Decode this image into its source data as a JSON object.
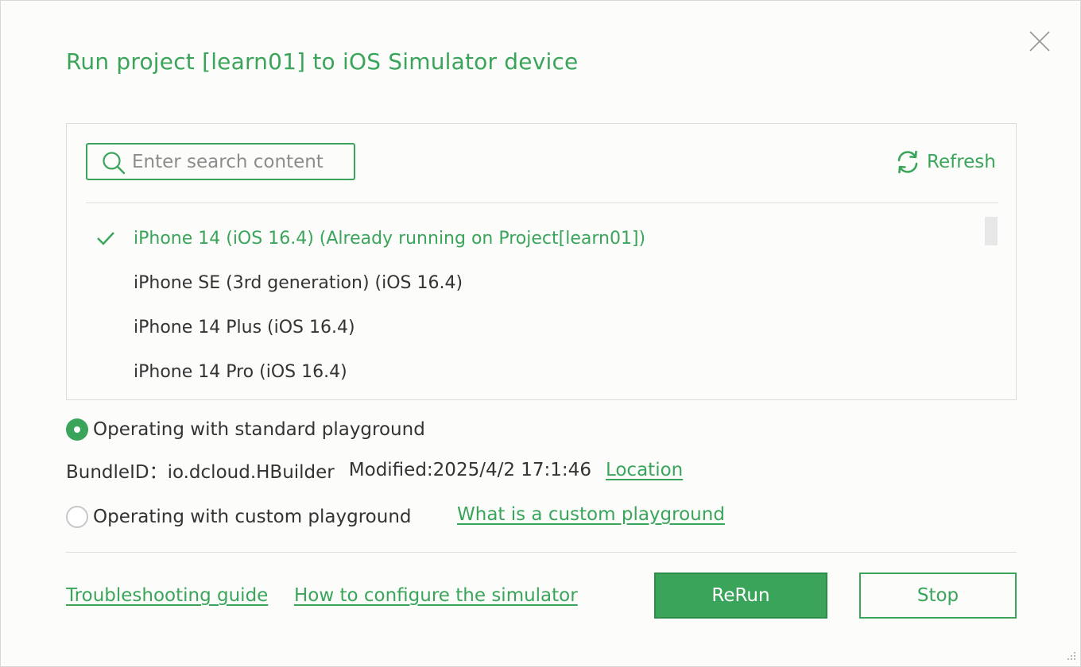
{
  "dialog": {
    "title": "Run project [learn01] to iOS Simulator device"
  },
  "search": {
    "placeholder": "Enter search content",
    "value": ""
  },
  "refresh_label": "Refresh",
  "devices": [
    {
      "label": "iPhone 14 (iOS 16.4) (Already running on Project[learn01])",
      "selected": true
    },
    {
      "label": "iPhone SE (3rd generation) (iOS 16.4)",
      "selected": false
    },
    {
      "label": "iPhone 14 Plus (iOS 16.4)",
      "selected": false
    },
    {
      "label": "iPhone 14 Pro (iOS 16.4)",
      "selected": false
    }
  ],
  "playground": {
    "standard_label": "Operating with standard playground",
    "standard_selected": true,
    "bundle_id_label": "BundleID：io.dcloud.HBuilder",
    "modified_label": "Modified:2025/4/2 17:1:46",
    "location_link": "Location",
    "custom_label": "Operating with custom playground",
    "custom_selected": false,
    "custom_help_link": "What is a custom playground"
  },
  "footer": {
    "troubleshooting_link": "Troubleshooting guide",
    "configure_link": "How to configure the simulator",
    "rerun_label": "ReRun",
    "stop_label": "Stop"
  },
  "colors": {
    "accent": "#3aa55a",
    "text": "#333333",
    "background": "#fcfdfb"
  },
  "icons": {
    "close": "close-icon",
    "search": "search-icon",
    "refresh": "refresh-icon",
    "check": "checkmark-icon",
    "resize": "resize-grip-icon"
  }
}
